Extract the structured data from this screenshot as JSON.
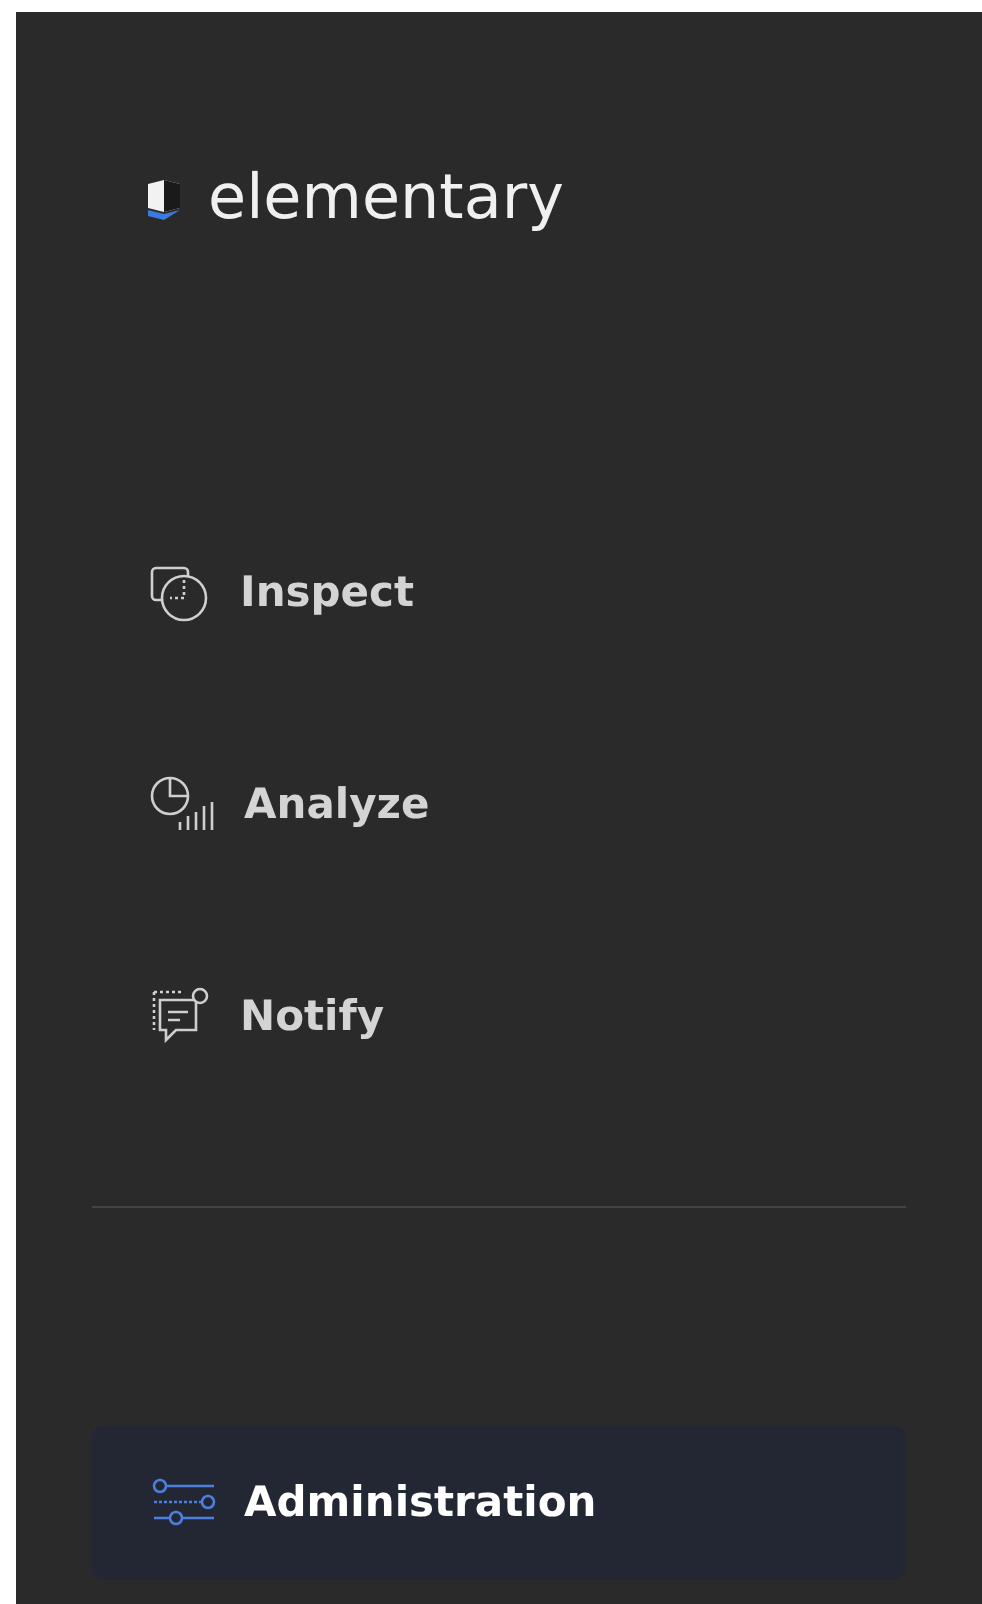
{
  "brand": {
    "name": "elementary"
  },
  "nav": [
    {
      "label": "Inspect",
      "kind": "inspect",
      "selected": false
    },
    {
      "label": "Analyze",
      "kind": "analyze",
      "selected": false
    },
    {
      "label": "Notify",
      "kind": "notify",
      "selected": false
    }
  ],
  "footer_nav": [
    {
      "label": "Administration",
      "kind": "admin",
      "selected": true
    }
  ]
}
